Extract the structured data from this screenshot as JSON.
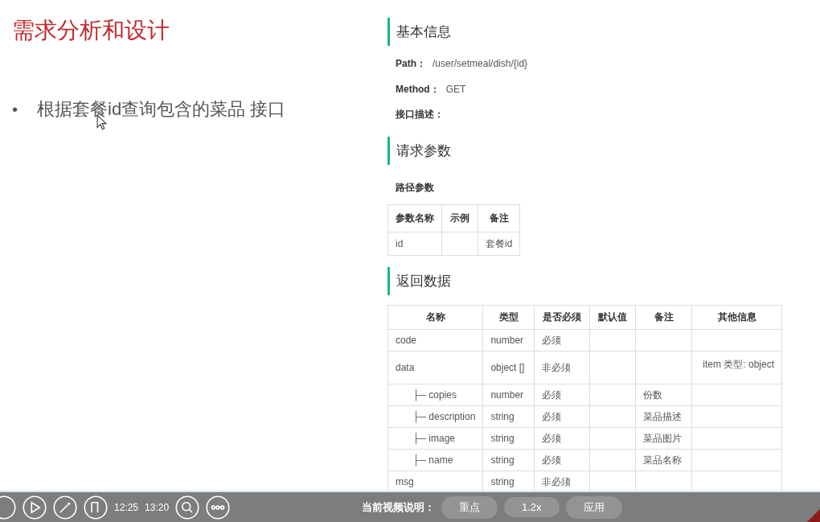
{
  "slide": {
    "title": "需求分析和设计",
    "bullets": [
      {
        "marker": "•",
        "text": "根据套餐id查询包含的菜品 接口"
      }
    ]
  },
  "doc": {
    "basic": {
      "heading": "基本信息",
      "fields": [
        {
          "label": "Path：",
          "value": "/user/setmeal/dish/{id}"
        },
        {
          "label": "Method：",
          "value": "GET"
        },
        {
          "label": "接口描述："
        }
      ]
    },
    "request": {
      "heading": "请求参数",
      "subheading": "路径参数",
      "table": {
        "columns": [
          "参数名称",
          "示例",
          "备注"
        ],
        "rows": [
          [
            "id",
            null,
            "套餐id"
          ]
        ]
      }
    },
    "response": {
      "heading": "返回数据",
      "table": {
        "columns": [
          "名称",
          "类型",
          "是否必须",
          "默认值",
          "备注",
          "其他信息"
        ],
        "rows": [
          {
            "cells": [
              "code",
              "number",
              "必须",
              null,
              null,
              null
            ]
          },
          {
            "cells": [
              "data",
              "object []",
              "非必须",
              null,
              null,
              "item 类型: object"
            ],
            "children": [
              {
                "cells": [
                  "├─ copies",
                  "number",
                  "必须",
                  null,
                  "份数",
                  null
                ]
              },
              {
                "cells": [
                  "├─ description",
                  "string",
                  "必须",
                  null,
                  "菜品描述",
                  null
                ]
              },
              {
                "cells": [
                  "├─ image",
                  "string",
                  "必须",
                  null,
                  "菜品图片",
                  null
                ]
              },
              {
                "cells": [
                  "├─ name",
                  "string",
                  "必须",
                  null,
                  "菜品名称",
                  null
                ]
              }
            ]
          },
          {
            "cells": [
              "msg",
              "string",
              "非必须",
              null,
              null,
              null
            ]
          }
        ]
      }
    }
  },
  "player": {
    "current_time": "12:25",
    "duration": "13:20",
    "note_label": "当前视频说明：",
    "chips": [
      "重点",
      "1.2x",
      "应用"
    ]
  }
}
